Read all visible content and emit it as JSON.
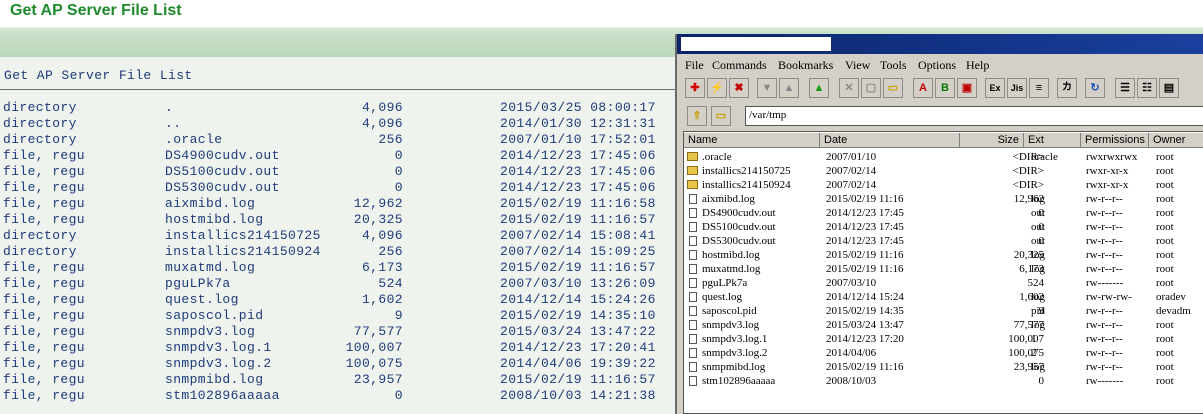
{
  "page_title": "Get AP Server File List",
  "left_list": {
    "heading": "Get AP Server File List",
    "rows": [
      {
        "type": "directory",
        "name": ".",
        "size": "4,096",
        "datetime": "2015/03/25 08:00:17"
      },
      {
        "type": "directory",
        "name": "..",
        "size": "4,096",
        "datetime": "2014/01/30 12:31:31"
      },
      {
        "type": "directory",
        "name": ".oracle",
        "size": "256",
        "datetime": "2007/01/10 17:52:01"
      },
      {
        "type": "file, regu",
        "name": "DS4900cudv.out",
        "size": "0",
        "datetime": "2014/12/23 17:45:06"
      },
      {
        "type": "file, regu",
        "name": "DS5100cudv.out",
        "size": "0",
        "datetime": "2014/12/23 17:45:06"
      },
      {
        "type": "file, regu",
        "name": "DS5300cudv.out",
        "size": "0",
        "datetime": "2014/12/23 17:45:06"
      },
      {
        "type": "file, regu",
        "name": "aixmibd.log",
        "size": "12,962",
        "datetime": "2015/02/19 11:16:58"
      },
      {
        "type": "file, regu",
        "name": "hostmibd.log",
        "size": "20,325",
        "datetime": "2015/02/19 11:16:57"
      },
      {
        "type": "directory",
        "name": "installics214150725",
        "size": "4,096",
        "datetime": "2007/02/14 15:08:41"
      },
      {
        "type": "directory",
        "name": "installics214150924",
        "size": "256",
        "datetime": "2007/02/14 15:09:25"
      },
      {
        "type": "file, regu",
        "name": "muxatmd.log",
        "size": "6,173",
        "datetime": "2015/02/19 11:16:57"
      },
      {
        "type": "file, regu",
        "name": "pguLPk7a",
        "size": "524",
        "datetime": "2007/03/10 13:26:09"
      },
      {
        "type": "file, regu",
        "name": "quest.log",
        "size": "1,602",
        "datetime": "2014/12/14 15:24:26"
      },
      {
        "type": "file, regu",
        "name": "saposcol.pid",
        "size": "9",
        "datetime": "2015/02/19 14:35:10"
      },
      {
        "type": "file, regu",
        "name": "snmpdv3.log",
        "size": "77,577",
        "datetime": "2015/03/24 13:47:22"
      },
      {
        "type": "file, regu",
        "name": "snmpdv3.log.1",
        "size": "100,007",
        "datetime": "2014/12/23 17:20:41"
      },
      {
        "type": "file, regu",
        "name": "snmpdv3.log.2",
        "size": "100,075",
        "datetime": "2014/04/06 19:39:22"
      },
      {
        "type": "file, regu",
        "name": "snmpmibd.log",
        "size": "23,957",
        "datetime": "2015/02/19 11:16:57"
      },
      {
        "type": "file, regu",
        "name": "stm102896aaaaa",
        "size": "0",
        "datetime": "2008/10/03 14:21:38"
      }
    ]
  },
  "file_manager": {
    "menu": [
      "File",
      "Commands",
      "Bookmarks",
      "View",
      "Tools",
      "Options",
      "Help"
    ],
    "toolbar_labels": {
      "a": "A",
      "b": "B",
      "exe": "Ex",
      "jis": "Jis",
      "kana": "カ"
    },
    "path": "/var/tmp",
    "columns": [
      "Name",
      "Date",
      "Size",
      "Ext",
      "Permissions",
      "Owner"
    ],
    "rows": [
      {
        "icon": "folder-icon",
        "name": ".oracle",
        "date": "2007/01/10",
        "size": "<DIR>",
        "ext": "oracle",
        "perm": "rwxrwxrwx",
        "owner": "root"
      },
      {
        "icon": "folder-icon",
        "name": "installics214150725",
        "date": "2007/02/14",
        "size": "<DIR>",
        "ext": "",
        "perm": "rwxr-xr-x",
        "owner": "root"
      },
      {
        "icon": "folder-icon",
        "name": "installics214150924",
        "date": "2007/02/14",
        "size": "<DIR>",
        "ext": "",
        "perm": "rwxr-xr-x",
        "owner": "root"
      },
      {
        "icon": "file-icon",
        "name": "aixmibd.log",
        "date": "2015/02/19 11:16",
        "size": "12,962",
        "ext": "log",
        "perm": "rw-r--r--",
        "owner": "root"
      },
      {
        "icon": "file-icon",
        "name": "DS4900cudv.out",
        "date": "2014/12/23 17:45",
        "size": "0",
        "ext": "out",
        "perm": "rw-r--r--",
        "owner": "root"
      },
      {
        "icon": "file-icon",
        "name": "DS5100cudv.out",
        "date": "2014/12/23 17:45",
        "size": "0",
        "ext": "out",
        "perm": "rw-r--r--",
        "owner": "root"
      },
      {
        "icon": "file-icon",
        "name": "DS5300cudv.out",
        "date": "2014/12/23 17:45",
        "size": "0",
        "ext": "out",
        "perm": "rw-r--r--",
        "owner": "root"
      },
      {
        "icon": "file-icon",
        "name": "hostmibd.log",
        "date": "2015/02/19 11:16",
        "size": "20,325",
        "ext": "log",
        "perm": "rw-r--r--",
        "owner": "root"
      },
      {
        "icon": "file-icon",
        "name": "muxatmd.log",
        "date": "2015/02/19 11:16",
        "size": "6,173",
        "ext": "log",
        "perm": "rw-r--r--",
        "owner": "root"
      },
      {
        "icon": "file-icon",
        "name": "pguLPk7a",
        "date": "2007/03/10",
        "size": "524",
        "ext": "",
        "perm": "rw-------",
        "owner": "root"
      },
      {
        "icon": "file-icon",
        "name": "quest.log",
        "date": "2014/12/14 15:24",
        "size": "1,602",
        "ext": "log",
        "perm": "rw-rw-rw-",
        "owner": "oradev"
      },
      {
        "icon": "file-icon",
        "name": "saposcol.pid",
        "date": "2015/02/19 14:35",
        "size": "9",
        "ext": "pid",
        "perm": "rw-r--r--",
        "owner": "devadm"
      },
      {
        "icon": "file-icon",
        "name": "snmpdv3.log",
        "date": "2015/03/24 13:47",
        "size": "77,577",
        "ext": "log",
        "perm": "rw-r--r--",
        "owner": "root"
      },
      {
        "icon": "file-icon",
        "name": "snmpdv3.log.1",
        "date": "2014/12/23 17:20",
        "size": "100,007",
        "ext": "1",
        "perm": "rw-r--r--",
        "owner": "root"
      },
      {
        "icon": "file-icon",
        "name": "snmpdv3.log.2",
        "date": "2014/04/06",
        "size": "100,075",
        "ext": "2",
        "perm": "rw-r--r--",
        "owner": "root"
      },
      {
        "icon": "file-icon",
        "name": "snmpmibd.log",
        "date": "2015/02/19 11:16",
        "size": "23,957",
        "ext": "log",
        "perm": "rw-r--r--",
        "owner": "root"
      },
      {
        "icon": "file-icon",
        "name": "stm102896aaaaa",
        "date": "2008/10/03",
        "size": "0",
        "ext": "",
        "perm": "rw-------",
        "owner": "root"
      }
    ]
  },
  "colors": {
    "title_green": "#1f8a2c",
    "list_text": "#1f3b7a",
    "panel_bg": "#eef3ee",
    "window_gray": "#d4d0c8",
    "titlebar_blue": "#0a246a",
    "folder_yellow": "#e8c44a"
  }
}
